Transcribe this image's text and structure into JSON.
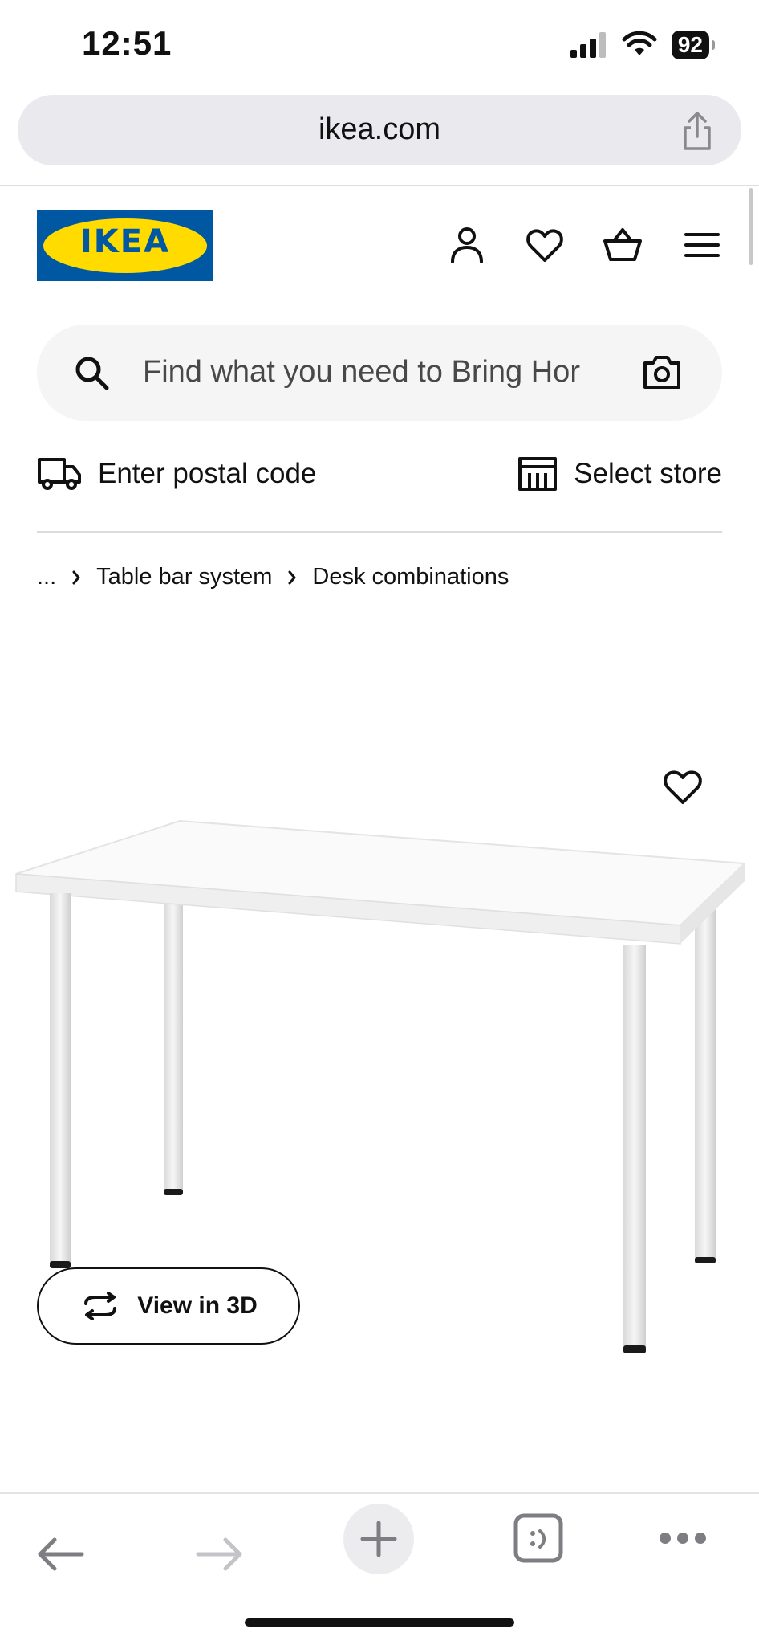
{
  "status_bar": {
    "time": "12:51",
    "battery": "92"
  },
  "browser": {
    "url": "ikea.com"
  },
  "header": {
    "logo_text": "IKEA",
    "icons": [
      "account-icon",
      "heart-icon",
      "basket-icon",
      "menu-icon"
    ]
  },
  "search": {
    "placeholder": "Find what you need to Bring Hor"
  },
  "delivery": {
    "postal_label": "Enter postal code",
    "store_label": "Select store"
  },
  "breadcrumb": {
    "ellipsis": "...",
    "items": [
      "Table bar system",
      "Desk combinations"
    ]
  },
  "product": {
    "view_3d_label": "View in 3D"
  },
  "colors": {
    "ikea_blue": "#0058a3",
    "ikea_yellow": "#ffdb00",
    "url_bar_bg": "#e9e9ee",
    "search_bg": "#f5f5f5"
  }
}
